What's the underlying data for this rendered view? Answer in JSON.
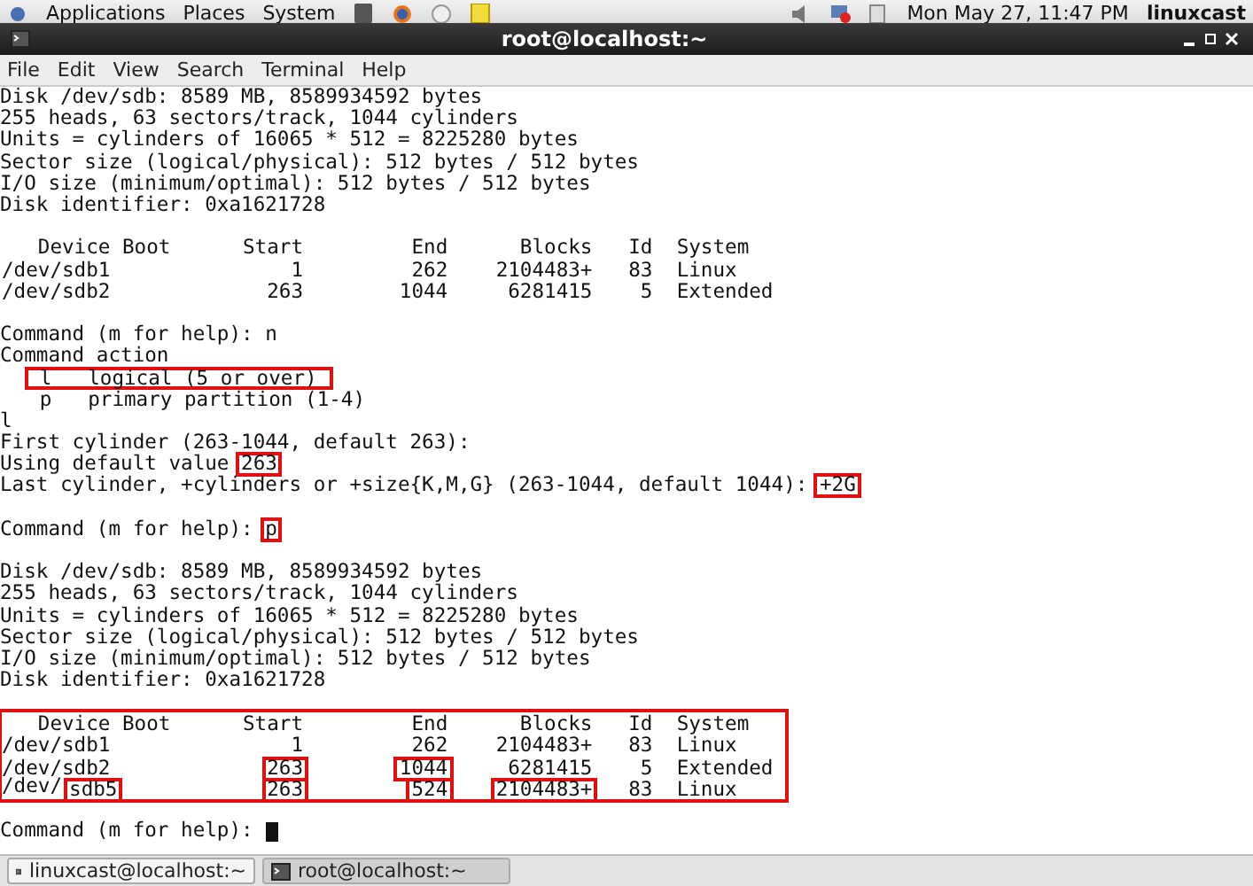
{
  "top_panel": {
    "menus": [
      "Applications",
      "Places",
      "System"
    ],
    "clock": "Mon May 27, 11:47 PM",
    "user": "linuxcast"
  },
  "window": {
    "title": "root@localhost:~"
  },
  "menu_bar": [
    "File",
    "Edit",
    "View",
    "Search",
    "Terminal",
    "Help"
  ],
  "terminal": {
    "items": [
      {
        "kind": "line",
        "segments": [
          {
            "text": "Disk /dev/sdb: 8589 MB, 8589934592 bytes",
            "boxed": false
          }
        ]
      },
      {
        "kind": "line",
        "segments": [
          {
            "text": "255 heads, 63 sectors/track, 1044 cylinders",
            "boxed": false
          }
        ]
      },
      {
        "kind": "line",
        "segments": [
          {
            "text": "Units = cylinders of 16065 * 512 = 8225280 bytes",
            "boxed": false
          }
        ]
      },
      {
        "kind": "line",
        "segments": [
          {
            "text": "Sector size (logical/physical): 512 bytes / 512 bytes",
            "boxed": false
          }
        ]
      },
      {
        "kind": "line",
        "segments": [
          {
            "text": "I/O size (minimum/optimal): 512 bytes / 512 bytes",
            "boxed": false
          }
        ]
      },
      {
        "kind": "line",
        "segments": [
          {
            "text": "Disk identifier: 0xa1621728",
            "boxed": false
          }
        ]
      },
      {
        "kind": "blank"
      },
      {
        "kind": "table",
        "boxed": false,
        "header": [
          "Device Boot",
          "Start",
          "End",
          "Blocks",
          "Id",
          "System"
        ],
        "rows": [
          [
            [
              {
                "text": "/dev/sdb1",
                "boxed": false
              }
            ],
            [
              {
                "text": "1",
                "boxed": false
              }
            ],
            [
              {
                "text": "262",
                "boxed": false
              }
            ],
            [
              {
                "text": "2104483+",
                "boxed": false
              }
            ],
            [
              {
                "text": "83",
                "boxed": false
              }
            ],
            [
              {
                "text": "Linux",
                "boxed": false
              }
            ]
          ],
          [
            [
              {
                "text": "/dev/sdb2",
                "boxed": false
              }
            ],
            [
              {
                "text": "263",
                "boxed": false
              }
            ],
            [
              {
                "text": "1044",
                "boxed": false
              }
            ],
            [
              {
                "text": "6281415",
                "boxed": false
              }
            ],
            [
              {
                "text": "5",
                "boxed": false
              }
            ],
            [
              {
                "text": "Extended",
                "boxed": false
              }
            ]
          ]
        ]
      },
      {
        "kind": "blank"
      },
      {
        "kind": "line",
        "segments": [
          {
            "text": "Command (m for help): n",
            "boxed": false
          }
        ]
      },
      {
        "kind": "line",
        "segments": [
          {
            "text": "Command action",
            "boxed": false
          }
        ]
      },
      {
        "kind": "option",
        "key": "l",
        "text": "logical (5 or over)",
        "boxed": true
      },
      {
        "kind": "option",
        "key": "p",
        "text": "primary partition (1-4)",
        "boxed": false
      },
      {
        "kind": "line",
        "segments": [
          {
            "text": "l",
            "boxed": false
          }
        ]
      },
      {
        "kind": "line",
        "segments": [
          {
            "text": "First cylinder (263-1044, default 263):",
            "boxed": false
          }
        ]
      },
      {
        "kind": "line",
        "segments": [
          {
            "text": "Using default value",
            "boxed": false
          },
          {
            "text": "263",
            "boxed": true
          }
        ]
      },
      {
        "kind": "line",
        "segments": [
          {
            "text": "Last cylinder, +cylinders or +size{K,M,G} (263-1044, default 1044):",
            "boxed": false
          },
          {
            "text": "+2G",
            "boxed": true
          }
        ]
      },
      {
        "kind": "blank"
      },
      {
        "kind": "line",
        "segments": [
          {
            "text": "Command (m for help):",
            "boxed": false
          },
          {
            "text": "p",
            "boxed": true
          }
        ]
      },
      {
        "kind": "blank"
      },
      {
        "kind": "line",
        "segments": [
          {
            "text": "Disk /dev/sdb: 8589 MB, 8589934592 bytes",
            "boxed": false
          }
        ]
      },
      {
        "kind": "line",
        "segments": [
          {
            "text": "255 heads, 63 sectors/track, 1044 cylinders",
            "boxed": false
          }
        ]
      },
      {
        "kind": "line",
        "segments": [
          {
            "text": "Units = cylinders of 16065 * 512 = 8225280 bytes",
            "boxed": false
          }
        ]
      },
      {
        "kind": "line",
        "segments": [
          {
            "text": "Sector size (logical/physical): 512 bytes / 512 bytes",
            "boxed": false
          }
        ]
      },
      {
        "kind": "line",
        "segments": [
          {
            "text": "I/O size (minimum/optimal): 512 bytes / 512 bytes",
            "boxed": false
          }
        ]
      },
      {
        "kind": "line",
        "segments": [
          {
            "text": "Disk identifier: 0xa1621728",
            "boxed": false
          }
        ]
      },
      {
        "kind": "blank"
      },
      {
        "kind": "table",
        "boxed": true,
        "header": [
          "Device Boot",
          "Start",
          "End",
          "Blocks",
          "Id",
          "System"
        ],
        "rows": [
          [
            [
              {
                "text": "/dev/sdb1",
                "boxed": false
              }
            ],
            [
              {
                "text": "1",
                "boxed": false
              }
            ],
            [
              {
                "text": "262",
                "boxed": false
              }
            ],
            [
              {
                "text": "2104483+",
                "boxed": false
              }
            ],
            [
              {
                "text": "83",
                "boxed": false
              }
            ],
            [
              {
                "text": "Linux",
                "boxed": false
              }
            ]
          ],
          [
            [
              {
                "text": "/dev/sdb2",
                "boxed": false
              }
            ],
            [
              {
                "text": "263",
                "boxed": true
              }
            ],
            [
              {
                "text": "1044",
                "boxed": true
              }
            ],
            [
              {
                "text": "6281415",
                "boxed": false
              }
            ],
            [
              {
                "text": "5",
                "boxed": false
              }
            ],
            [
              {
                "text": "Extended",
                "boxed": false
              }
            ]
          ],
          [
            [
              {
                "text": "/dev/",
                "boxed": false
              },
              {
                "text": "sdb5",
                "boxed": true
              }
            ],
            [
              {
                "text": "263",
                "boxed": true
              }
            ],
            [
              {
                "text": "524",
                "boxed": true
              }
            ],
            [
              {
                "text": "2104483+",
                "boxed": true
              }
            ],
            [
              {
                "text": "83",
                "boxed": false
              }
            ],
            [
              {
                "text": "Linux",
                "boxed": false
              }
            ]
          ]
        ]
      },
      {
        "kind": "blank"
      },
      {
        "kind": "line",
        "segments": [
          {
            "text": "Command (m for help):",
            "boxed": false
          }
        ]
      }
    ],
    "cursor": true
  },
  "taskbar": [
    {
      "label": "linuxcast@localhost:~",
      "selected": false
    },
    {
      "label": "root@localhost:~",
      "selected": true
    }
  ]
}
